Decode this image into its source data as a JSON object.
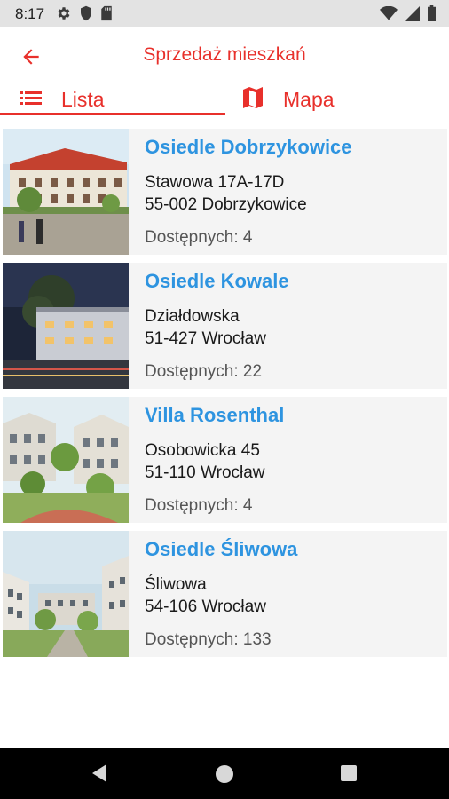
{
  "status_bar": {
    "time": "8:17",
    "left_icons": [
      "gear-icon",
      "shield-icon",
      "sd-card-icon"
    ],
    "right_icons": [
      "wifi-icon",
      "signal-icon",
      "battery-icon"
    ]
  },
  "app_bar": {
    "title": "Sprzedaż mieszkań",
    "back_icon": "arrow-left-icon"
  },
  "tabs": [
    {
      "label": "Lista",
      "icon": "list-icon",
      "selected": true
    },
    {
      "label": "Mapa",
      "icon": "map-icon",
      "selected": false
    }
  ],
  "colors": {
    "accent": "#e8302b",
    "link_blue": "#2e94e0",
    "card_bg": "#f4f4f4"
  },
  "estates": [
    {
      "name": "Osiedle Dobrzykowice",
      "street": "Stawowa 17A-17D",
      "city": "55-002 Dobrzykowice",
      "available": "Dostępnych: 4"
    },
    {
      "name": "Osiedle Kowale",
      "street": "Działdowska",
      "city": "51-427 Wrocław",
      "available": "Dostępnych: 22"
    },
    {
      "name": "Villa Rosenthal",
      "street": "Osobowicka 45",
      "city": "51-110 Wrocław",
      "available": "Dostępnych: 4"
    },
    {
      "name": "Osiedle Śliwowa",
      "street": "Śliwowa",
      "city": "54-106 Wrocław",
      "available": "Dostępnych: 133"
    }
  ],
  "nav_bar": {
    "buttons": [
      "back-triangle-icon",
      "home-circle-icon",
      "recents-square-icon"
    ]
  }
}
